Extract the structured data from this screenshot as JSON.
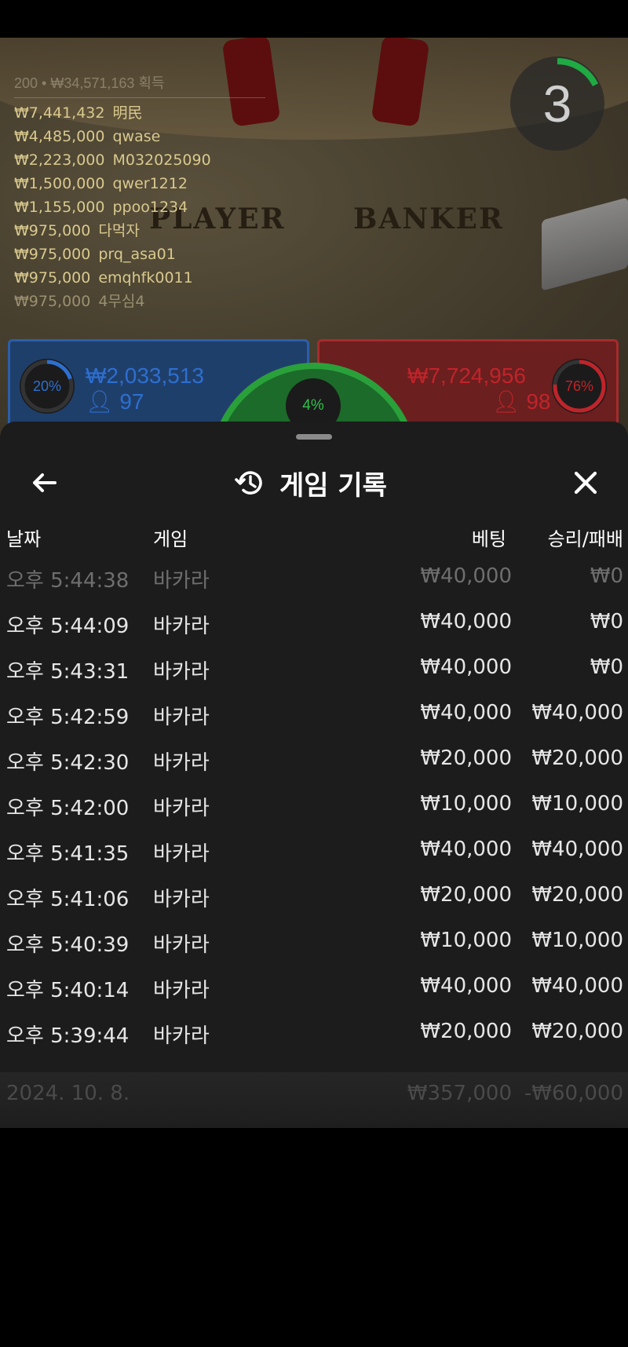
{
  "game_view": {
    "leaderboard": {
      "total": "200 • ₩34,571,163 획득",
      "entries": [
        {
          "amount": "₩7,441,432",
          "name": "明民"
        },
        {
          "amount": "₩4,485,000",
          "name": "qwase"
        },
        {
          "amount": "₩2,223,000",
          "name": "M032025090"
        },
        {
          "amount": "₩1,500,000",
          "name": "qwer1212"
        },
        {
          "amount": "₩1,155,000",
          "name": "ppoo1234"
        },
        {
          "amount": "₩975,000",
          "name": "다먹자"
        },
        {
          "amount": "₩975,000",
          "name": "prq_asa01"
        },
        {
          "amount": "₩975,000",
          "name": "emqhfk0011"
        },
        {
          "amount": "₩975,000",
          "name": "4무심4"
        }
      ]
    },
    "countdown": "3",
    "table_labels": {
      "player": "PLAYER",
      "banker": "BANKER"
    },
    "player_bet": {
      "percent": "20%",
      "percent_value": 0.2,
      "amount": "₩2,033,513",
      "count": "97"
    },
    "banker_bet": {
      "percent": "76%",
      "percent_value": 0.76,
      "amount": "₩7,724,956",
      "count": "98"
    },
    "tie_bet": {
      "percent": "4%"
    }
  },
  "sheet": {
    "title": "게임 기록",
    "columns": {
      "date": "날짜",
      "game": "게임",
      "bet": "베팅",
      "result": "승리/패배"
    },
    "rows": [
      {
        "time": "오후 5:44:38",
        "game": "바카라",
        "bet": "₩40,000",
        "result": "₩0"
      },
      {
        "time": "오후 5:44:09",
        "game": "바카라",
        "bet": "₩40,000",
        "result": "₩0"
      },
      {
        "time": "오후 5:43:31",
        "game": "바카라",
        "bet": "₩40,000",
        "result": "₩0"
      },
      {
        "time": "오후 5:42:59",
        "game": "바카라",
        "bet": "₩40,000",
        "result": "₩40,000"
      },
      {
        "time": "오후 5:42:30",
        "game": "바카라",
        "bet": "₩20,000",
        "result": "₩20,000"
      },
      {
        "time": "오후 5:42:00",
        "game": "바카라",
        "bet": "₩10,000",
        "result": "₩10,000"
      },
      {
        "time": "오후 5:41:35",
        "game": "바카라",
        "bet": "₩40,000",
        "result": "₩40,000"
      },
      {
        "time": "오후 5:41:06",
        "game": "바카라",
        "bet": "₩20,000",
        "result": "₩20,000"
      },
      {
        "time": "오후 5:40:39",
        "game": "바카라",
        "bet": "₩10,000",
        "result": "₩10,000"
      },
      {
        "time": "오후 5:40:14",
        "game": "바카라",
        "bet": "₩40,000",
        "result": "₩40,000"
      },
      {
        "time": "오후 5:39:44",
        "game": "바카라",
        "bet": "₩20,000",
        "result": "₩20,000"
      }
    ],
    "summary": {
      "date": "2024. 10. 8.",
      "bet_total": "₩357,000",
      "result_total": "-₩60,000"
    }
  },
  "icons": {
    "back": "arrow-left-icon",
    "history": "history-icon",
    "close": "close-icon",
    "person": "person-icon"
  },
  "colors": {
    "player": "#1f3f6b",
    "player_text": "#2d6fd0",
    "banker": "#6b1f1f",
    "banker_text": "#c0242a",
    "tie": "#2ec24a",
    "sheet_bg": "#1c1c1c"
  }
}
